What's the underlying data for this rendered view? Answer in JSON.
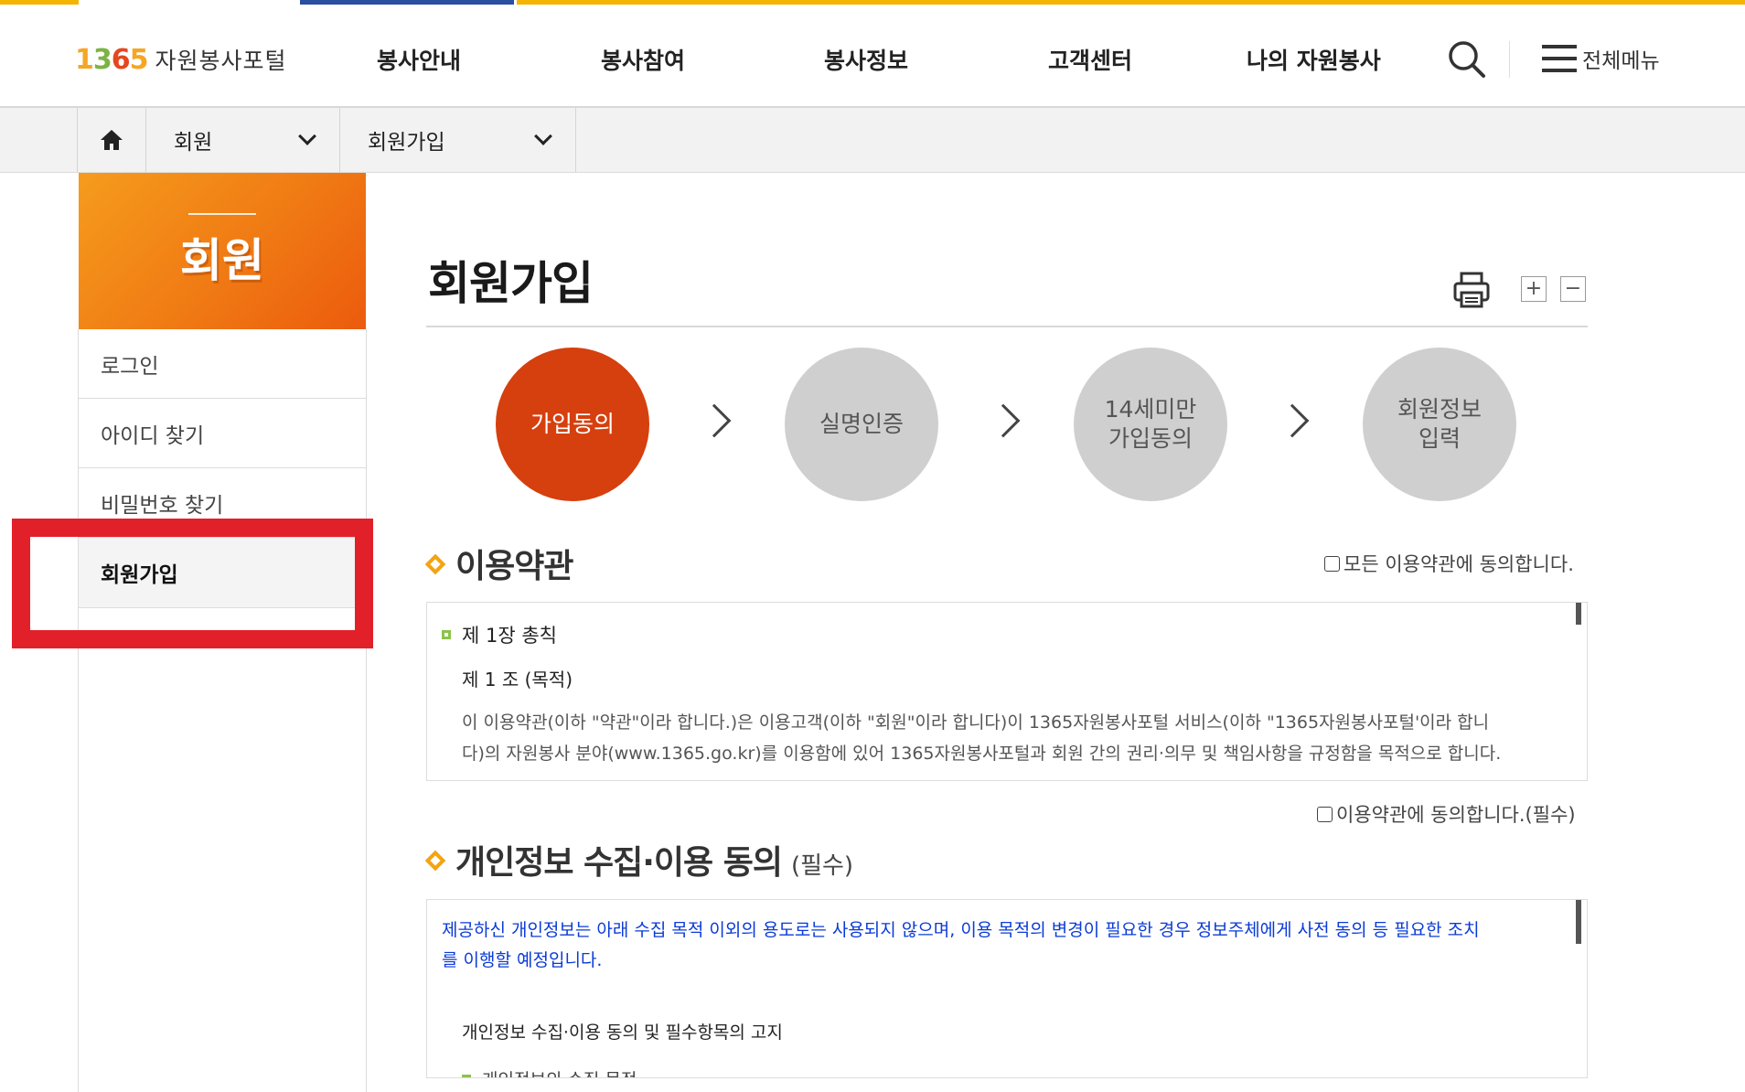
{
  "header": {
    "logo_num": [
      "1",
      "3",
      "6",
      "5"
    ],
    "logo_text": "자원봉사포털",
    "nav": [
      "봉사안내",
      "봉사참여",
      "봉사정보",
      "고객센터",
      "나의 자원봉사"
    ],
    "search_icon": "search-icon",
    "all_menu_label": "전체메뉴"
  },
  "breadcrumb": {
    "home_icon": "home-icon",
    "level1": "회원",
    "level2": "회원가입"
  },
  "sidebar": {
    "title": "회원",
    "items": [
      {
        "label": "로그인",
        "active": false
      },
      {
        "label": "아이디 찾기",
        "active": false
      },
      {
        "label": "비밀번호 찾기",
        "active": false
      },
      {
        "label": "회원가입",
        "active": true
      }
    ]
  },
  "main": {
    "title": "회원가입",
    "print_icon": "printer-icon",
    "zoom_in": "+",
    "zoom_out": "−",
    "steps": [
      {
        "label": "가입동의",
        "active": true
      },
      {
        "label": "실명인증",
        "active": false
      },
      {
        "label": "14세미만\n가입동의",
        "active": false
      },
      {
        "label": "회원정보\n입력",
        "active": false
      }
    ],
    "terms": {
      "title": "이용약관",
      "agree_all": "모든 이용약관에 동의합니다.",
      "chapter": "제 1장 총칙",
      "article": "제 1 조 (목적)",
      "body_line1": "이 이용약관(이하 \"약관\"이라 합니다.)은 이용고객(이하 \"회원\"이라 합니다)이 1365자원봉사포털 서비스(이하 \"1365자원봉사포털'이라 합니",
      "body_line2": "다)의 자원봉사 분야(www.1365.go.kr)를 이용함에 있어 1365자원봉사포털과 회원 간의 권리·의무 및 책임사항을 규정함을 목적으로 합니다.",
      "agree": "이용약관에 동의합니다.(필수)"
    },
    "privacy": {
      "title": "개인정보 수집·이용 동의",
      "required": "(필수)",
      "notice_line1": "제공하신 개인정보는 아래 수집 목적 이외의 용도로는 사용되지 않으며, 이용 목적의 변경이 필요한 경우 정보주체에게 사전 동의 등 필요한 조치",
      "notice_line2": "를 이행할 예정입니다.",
      "heading": "개인정보 수집·이용 동의 및 필수항목의 고지",
      "item1": "개인정보의 수집 목적"
    }
  },
  "colors": {
    "accent_orange": "#f07a14",
    "step_active": "#d63f0e",
    "step_inactive": "#cfcfcf",
    "highlight": "#e2202a",
    "notice_blue": "#0b3bd6",
    "strip_orange": "#f5b400",
    "strip_navy": "#2a4ea0"
  }
}
